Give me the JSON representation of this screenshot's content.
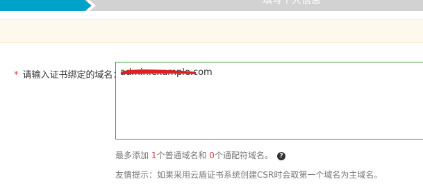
{
  "steps": {
    "current_label": "填写个人信息"
  },
  "form": {
    "domain_label": "请输入证书绑定的域名：",
    "required_mark": "*",
    "domain_value": "admin.example.com"
  },
  "hints": {
    "limit_prefix": "最多添加 ",
    "normal_count": "1",
    "limit_middle": "个普通域名和 ",
    "wildcard_count": "0",
    "limit_suffix": "个通配符域名。",
    "help_icon": "question-circle-icon",
    "help_glyph": "?",
    "tip_text": "友情提示：如果采用云盾证书系统创建CSR时会取第一个域名为主域名。"
  },
  "colors": {
    "accent": "#00a2ca",
    "required": "#e4393c",
    "input_border": "#3c9b3c",
    "notice_bg": "#fdf9ec",
    "redaction": "#e02020"
  }
}
